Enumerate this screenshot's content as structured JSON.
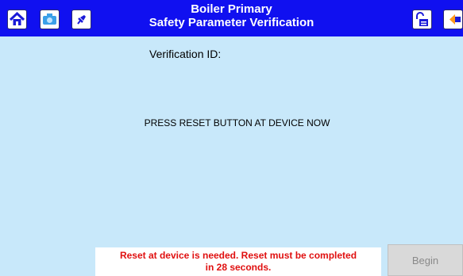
{
  "header": {
    "title_line1": "Boiler Primary",
    "title_line2": "Safety Parameter Verification",
    "icons_left": [
      "home-icon",
      "camera-icon",
      "pin-icon"
    ],
    "icons_right": [
      "unlock-icon",
      "back-icon"
    ]
  },
  "main": {
    "verification_label": "Verification ID:",
    "prompt": "PRESS RESET BUTTON AT DEVICE NOW"
  },
  "footer": {
    "message_line1": "Reset at device is needed. Reset must be completed",
    "message_line2": "in 28 seconds.",
    "begin_label": "Begin"
  },
  "colors": {
    "header_bg": "#1010f0",
    "body_bg": "#c8e8fa",
    "message_text": "#e01010"
  }
}
